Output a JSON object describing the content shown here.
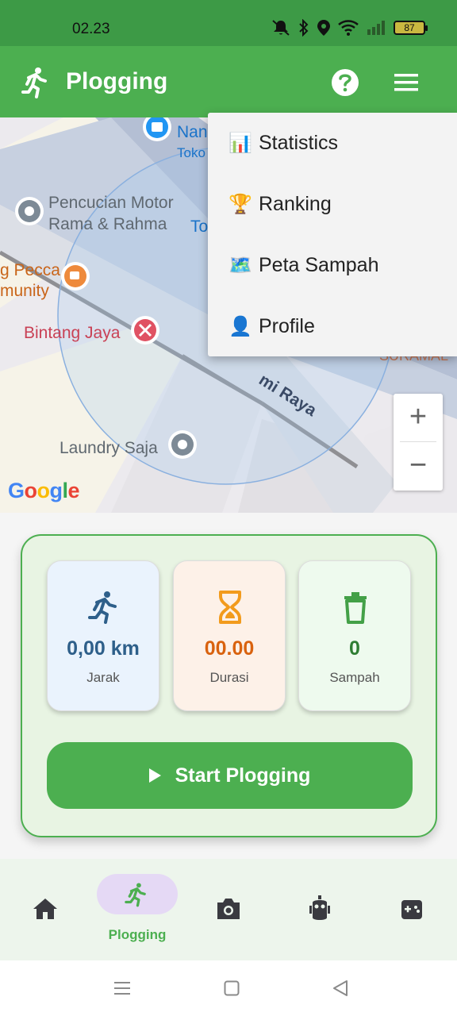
{
  "status_bar": {
    "time": "02.23",
    "battery": "87",
    "icons": [
      "mute-icon",
      "bluetooth-icon",
      "location-icon",
      "wifi-icon",
      "signal-icon",
      "battery-icon"
    ]
  },
  "app_bar": {
    "title": "Plogging",
    "logo_icon": "runner-icon",
    "actions": [
      "help-icon",
      "hamburger-menu-icon"
    ],
    "color": "#4caf50"
  },
  "map": {
    "labels": {
      "nan": "Nan",
      "toko": "Toko",
      "pencucian_1": "Pencucian Motor",
      "pencucian_2": "Rama & Rahma",
      "to": "To",
      "pecca_1": "g Pecca",
      "pecca_2": "munity",
      "bintang": "Bintang Jaya",
      "road": "mi Raya",
      "suramal": "SURAMAL",
      "laundry": "Laundry Saja",
      "google": "Google"
    },
    "zoom_in": "+",
    "zoom_out": "−"
  },
  "menu": {
    "items": [
      {
        "emoji": "📊",
        "label": "Statistics"
      },
      {
        "emoji": "🏆",
        "label": "Ranking"
      },
      {
        "emoji": "🗺️",
        "label": "Peta Sampah"
      },
      {
        "emoji": "👤",
        "label": "Profile"
      }
    ]
  },
  "stats": {
    "distance": {
      "value": "0,00 km",
      "label": "Jarak",
      "icon": "runner-icon",
      "color": "#2e5f8a"
    },
    "duration": {
      "value": "00.00",
      "label": "Durasi",
      "icon": "hourglass-icon",
      "color": "#d9620e"
    },
    "trash": {
      "value": "0",
      "label": "Sampah",
      "icon": "trash-icon",
      "color": "#2e7d32"
    }
  },
  "start_button": {
    "label": "Start Plogging"
  },
  "bottom_nav": {
    "items": [
      {
        "icon": "home-icon"
      },
      {
        "icon": "runner-icon",
        "label": "Plogging",
        "active": true
      },
      {
        "icon": "camera-icon"
      },
      {
        "icon": "robot-icon"
      },
      {
        "icon": "gamepad-icon"
      }
    ]
  },
  "system_nav": [
    "recents-icon",
    "home-square-icon",
    "back-icon"
  ]
}
